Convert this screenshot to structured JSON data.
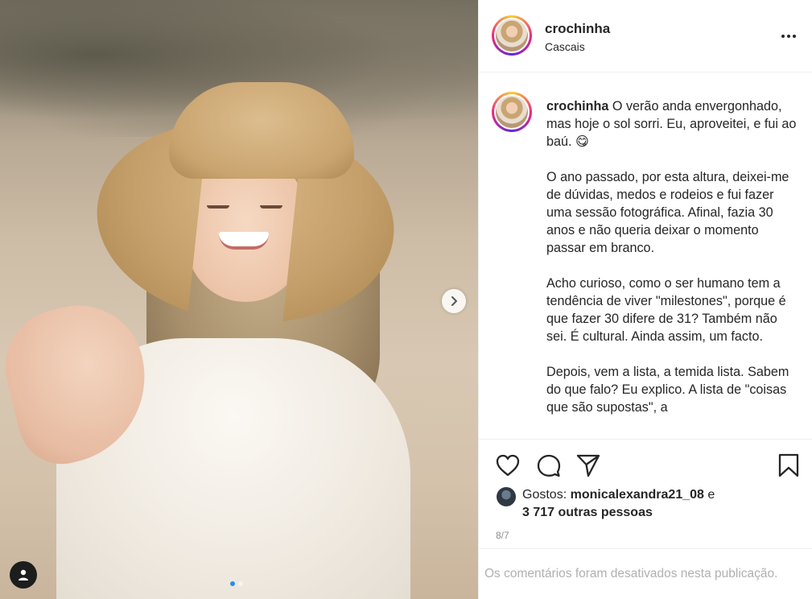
{
  "post": {
    "username": "crochinha",
    "location": "Cascais",
    "caption_paragraphs": [
      "O verão anda envergonhado, mas hoje o sol sorri. Eu, aproveitei, e fui ao baú. 😋",
      "O ano passado, por esta altura, deixei-me de dúvidas, medos e rodeios e fui fazer uma sessão fotográfica. Afinal, fazia 30 anos e não queria deixar o momento passar em branco.",
      "Acho curioso, como o ser humano tem a tendência de viver \"milestones\", porque é que fazer 30 difere de 31? Também não sei. É cultural. Ainda assim, um facto.",
      "Depois, vem a lista, a temida lista. Sabem do que falo? Eu explico. A lista de \"coisas que são supostas\", a"
    ],
    "likes_prefix": "Gostos:",
    "liked_by": "monicalexandra21_08",
    "likes_connector": "e",
    "others_count": "3 717 outras pessoas",
    "date": "8/7",
    "comments_disabled_text": "Os comentários foram desativados nesta publicação."
  },
  "carousel": {
    "current": 1,
    "total": 2
  },
  "icons": {
    "like": "heart-icon",
    "comment": "comment-icon",
    "share": "paper-plane-icon",
    "save": "bookmark-icon",
    "more": "more-dots-icon",
    "next": "chevron-right-icon",
    "tags": "user-tag-icon"
  },
  "colors": {
    "story_ring": [
      "#f9ce34",
      "#ee2a7b",
      "#6228d7"
    ],
    "carousel_active_dot": "#2b8cf0",
    "text": "#262626",
    "muted": "#8e8e8e"
  }
}
